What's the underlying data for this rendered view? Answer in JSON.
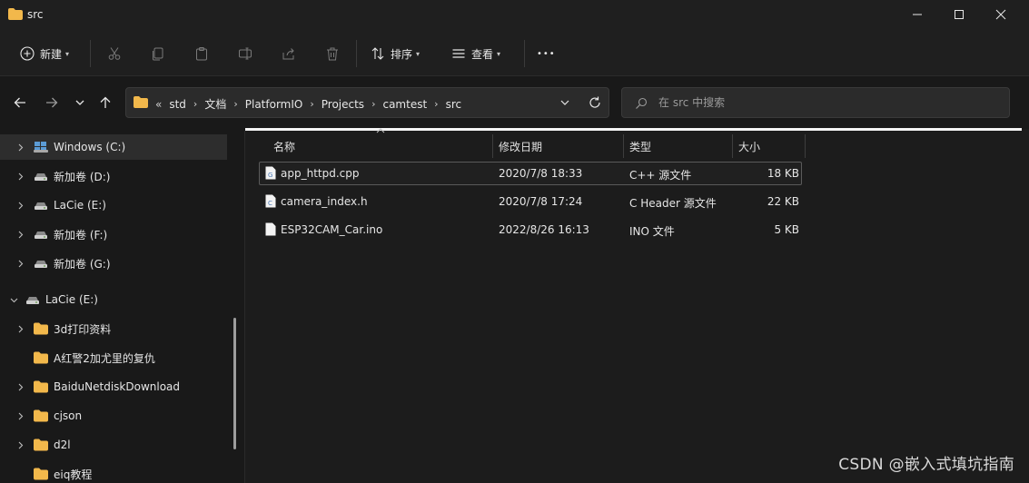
{
  "window": {
    "title": "src",
    "controls": {
      "minimize": "minimize-icon",
      "maximize": "maximize-icon",
      "close": "close-icon"
    }
  },
  "toolbar": {
    "new_label": "新建",
    "sort_label": "排序",
    "view_label": "查看",
    "more_label": "•••"
  },
  "address": {
    "overflow": "«",
    "crumbs": [
      "std",
      "文档",
      "PlatformIO",
      "Projects",
      "camtest",
      "src"
    ]
  },
  "search": {
    "placeholder": "在 src 中搜索",
    "value": ""
  },
  "sidebar": {
    "items": [
      {
        "label": "Windows (C:)",
        "icon": "windows-drive-icon",
        "expanded": false,
        "selected": true
      },
      {
        "label": "新加卷 (D:)",
        "icon": "drive-icon",
        "expanded": false
      },
      {
        "label": "LaCie  (E:)",
        "icon": "drive-icon",
        "expanded": false
      },
      {
        "label": "新加卷 (F:)",
        "icon": "drive-icon",
        "expanded": false
      },
      {
        "label": "新加卷 (G:)",
        "icon": "drive-icon",
        "expanded": false
      },
      {
        "label": "LaCie  (E:)",
        "icon": "drive-icon",
        "expanded": true
      },
      {
        "label": "3d打印资料",
        "icon": "folder-icon",
        "expanded": false
      },
      {
        "label": "A红警2加尤里的复仇",
        "icon": "folder-icon",
        "expanded": null
      },
      {
        "label": "BaiduNetdiskDownload",
        "icon": "folder-icon",
        "expanded": false
      },
      {
        "label": "cjson",
        "icon": "folder-icon",
        "expanded": false
      },
      {
        "label": "d2l",
        "icon": "folder-icon",
        "expanded": false
      },
      {
        "label": "eiq教程",
        "icon": "folder-icon",
        "expanded": null
      }
    ]
  },
  "columns": {
    "name": "名称",
    "modified": "修改日期",
    "type": "类型",
    "size": "大小"
  },
  "files": [
    {
      "name": "app_httpd.cpp",
      "modified": "2020/7/8 18:33",
      "type": "C++ 源文件",
      "size": "18 KB",
      "icon": "cpp-file-icon",
      "selected": true
    },
    {
      "name": "camera_index.h",
      "modified": "2020/7/8 17:24",
      "type": "C Header 源文件",
      "size": "22 KB",
      "icon": "header-file-icon",
      "selected": false
    },
    {
      "name": "ESP32CAM_Car.ino",
      "modified": "2022/8/26 16:13",
      "type": "INO 文件",
      "size": "5 KB",
      "icon": "blank-file-icon",
      "selected": false
    }
  ],
  "watermark": "CSDN @嵌入式填坑指南",
  "colors": {
    "folder": "#f2b84b",
    "accent_icon": "#5b9bd5",
    "background": "#1c1c1c"
  }
}
